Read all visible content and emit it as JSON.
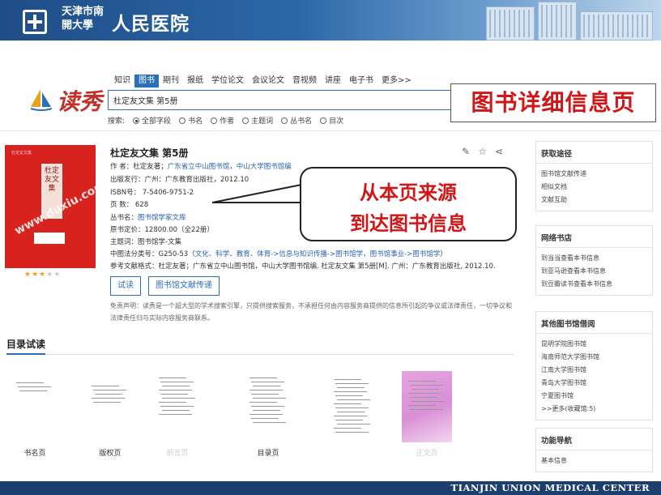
{
  "banner": {
    "subtitle": "天津市南開大學",
    "title": "人民医院",
    "footer": "TIANJIN UNION MEDICAL CENTER"
  },
  "search": {
    "logo": "读秀",
    "tabs": [
      "知识",
      "图书",
      "期刊",
      "报纸",
      "学位论文",
      "会议论文",
      "音视频",
      "讲座",
      "电子书",
      "更多>>"
    ],
    "active_tab": "图书",
    "query": "杜定友文集 第5册",
    "scope_label": "搜索:",
    "scope_options": [
      "全部字段",
      "书名",
      "作者",
      "主题词",
      "丛书名",
      "目次"
    ]
  },
  "annotation": {
    "label": "图书详细信息页",
    "callout_line1": "从本页来源",
    "callout_line2": "到达图书信息"
  },
  "cover": {
    "header": "杜定友文集",
    "spine": "杜定友文集",
    "watermark": "www.duxiu.com",
    "rating": 3,
    "rating_max": 5
  },
  "book": {
    "title": "杜定友文集 第5册",
    "author_label": "作 者：",
    "author_value": "杜定友著；",
    "author_orgs": "广东省立中山图书馆，中山大学图书馆编",
    "publish": "出版发行：广州：广东教育出版社，2012.10",
    "isbn": "ISBN号： 7-5406-9751-2",
    "pages": "页 数： 628",
    "series_label": "丛书名：",
    "series_value": "图书馆学家文库",
    "price": "原书定价：12800.00（全22册）",
    "subject": "主题词：图书馆学-文集",
    "clc_label": "中图法分类号：G250-53（",
    "clc_links": "文化、科学、教育、体育->信息与知识传播->图书馆学，图书馆事业->图书馆学",
    "clc_end": "）",
    "citation": "参考文献格式：杜定友著；广东省立中山图书馆，中山大学图书馆编. 杜定友文集 第5册[M]. 广州：广东教育出版社, 2012.10.",
    "btn_trial": "试读",
    "btn_delivery": "图书馆文献传递",
    "disclaimer": "免责声明：读秀是一个超大型的学术搜索引擎，只提供搜索服务，不承担任何由内容服务商提供的信息所引起的争议或法律责任，一切争议和法律责任归与实际内容服务商联系。"
  },
  "toc": {
    "title": "目录试读",
    "pages": [
      {
        "label": "书名页",
        "faded": false
      },
      {
        "label": "版权页",
        "faded": false
      },
      {
        "label": "前言页",
        "faded": true
      },
      {
        "label": "目录页",
        "faded": false
      },
      {
        "label": "",
        "faded": false
      },
      {
        "label": "正文页",
        "faded": true
      }
    ]
  },
  "sidebar": [
    {
      "title": "获取途径",
      "items": [
        "图书馆文献传递",
        "相似文档",
        "文献互助"
      ]
    },
    {
      "title": "网络书店",
      "items": [
        "到当当查看本书信息",
        "到亚马逊查看本书信息",
        "到豆瓣读书查看本书信息"
      ]
    },
    {
      "title": "其他图书馆借阅",
      "items": [
        "昆明学院图书馆",
        "海南师范大学图书馆",
        "江南大学图书馆",
        "青岛大学图书馆",
        "宁夏图书馆",
        ">>更多(收藏馆:5)"
      ]
    },
    {
      "title": "功能导航",
      "items": [
        "基本信息"
      ]
    }
  ],
  "colors": {
    "accent": "#2b6fb8",
    "highlight": "#d01616",
    "banner": "#1f4d86"
  }
}
